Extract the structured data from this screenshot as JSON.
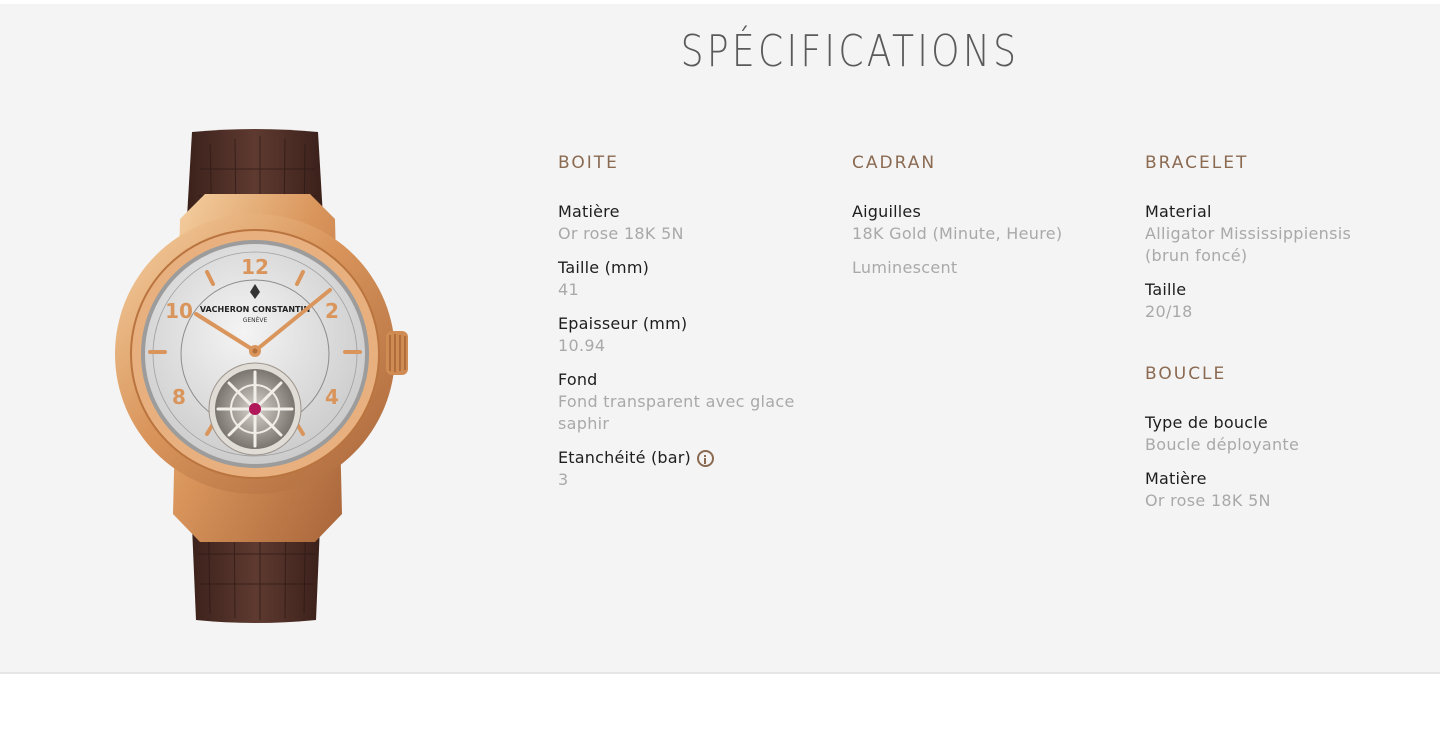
{
  "title": "SPÉCIFICATIONS",
  "watch_image": {
    "brand_text": "VACHERON CONSTANTIN",
    "city_text": "GENÈVE"
  },
  "colors": {
    "accent": "#8b6a52",
    "panel_bg": "#f4f4f4",
    "label": "#1e1e1e",
    "value": "#a9a9a9"
  },
  "boite": {
    "heading": "BOITE",
    "items": [
      {
        "label": "Matière",
        "value": "Or rose 18K 5N"
      },
      {
        "label": "Taille (mm)",
        "value": "41"
      },
      {
        "label": "Epaisseur (mm)",
        "value": "10.94"
      },
      {
        "label": "Fond",
        "value": "Fond transparent avec glace saphir"
      },
      {
        "label": "Etanchéité (bar)",
        "value": "3",
        "icon": "info-icon"
      }
    ]
  },
  "cadran": {
    "heading": "CADRAN",
    "items": [
      {
        "label": "Aiguilles",
        "value": "18K Gold (Minute, Heure)",
        "value2": "Luminescent"
      }
    ]
  },
  "bracelet": {
    "heading": "BRACELET",
    "items": [
      {
        "label": "Material",
        "value": "Alligator Mississippiensis (brun foncé)"
      },
      {
        "label": "Taille",
        "value": "20/18"
      }
    ]
  },
  "boucle": {
    "heading": "BOUCLE",
    "items": [
      {
        "label": "Type de boucle",
        "value": "Boucle déployante"
      },
      {
        "label": "Matière",
        "value": "Or rose 18K 5N"
      }
    ]
  }
}
